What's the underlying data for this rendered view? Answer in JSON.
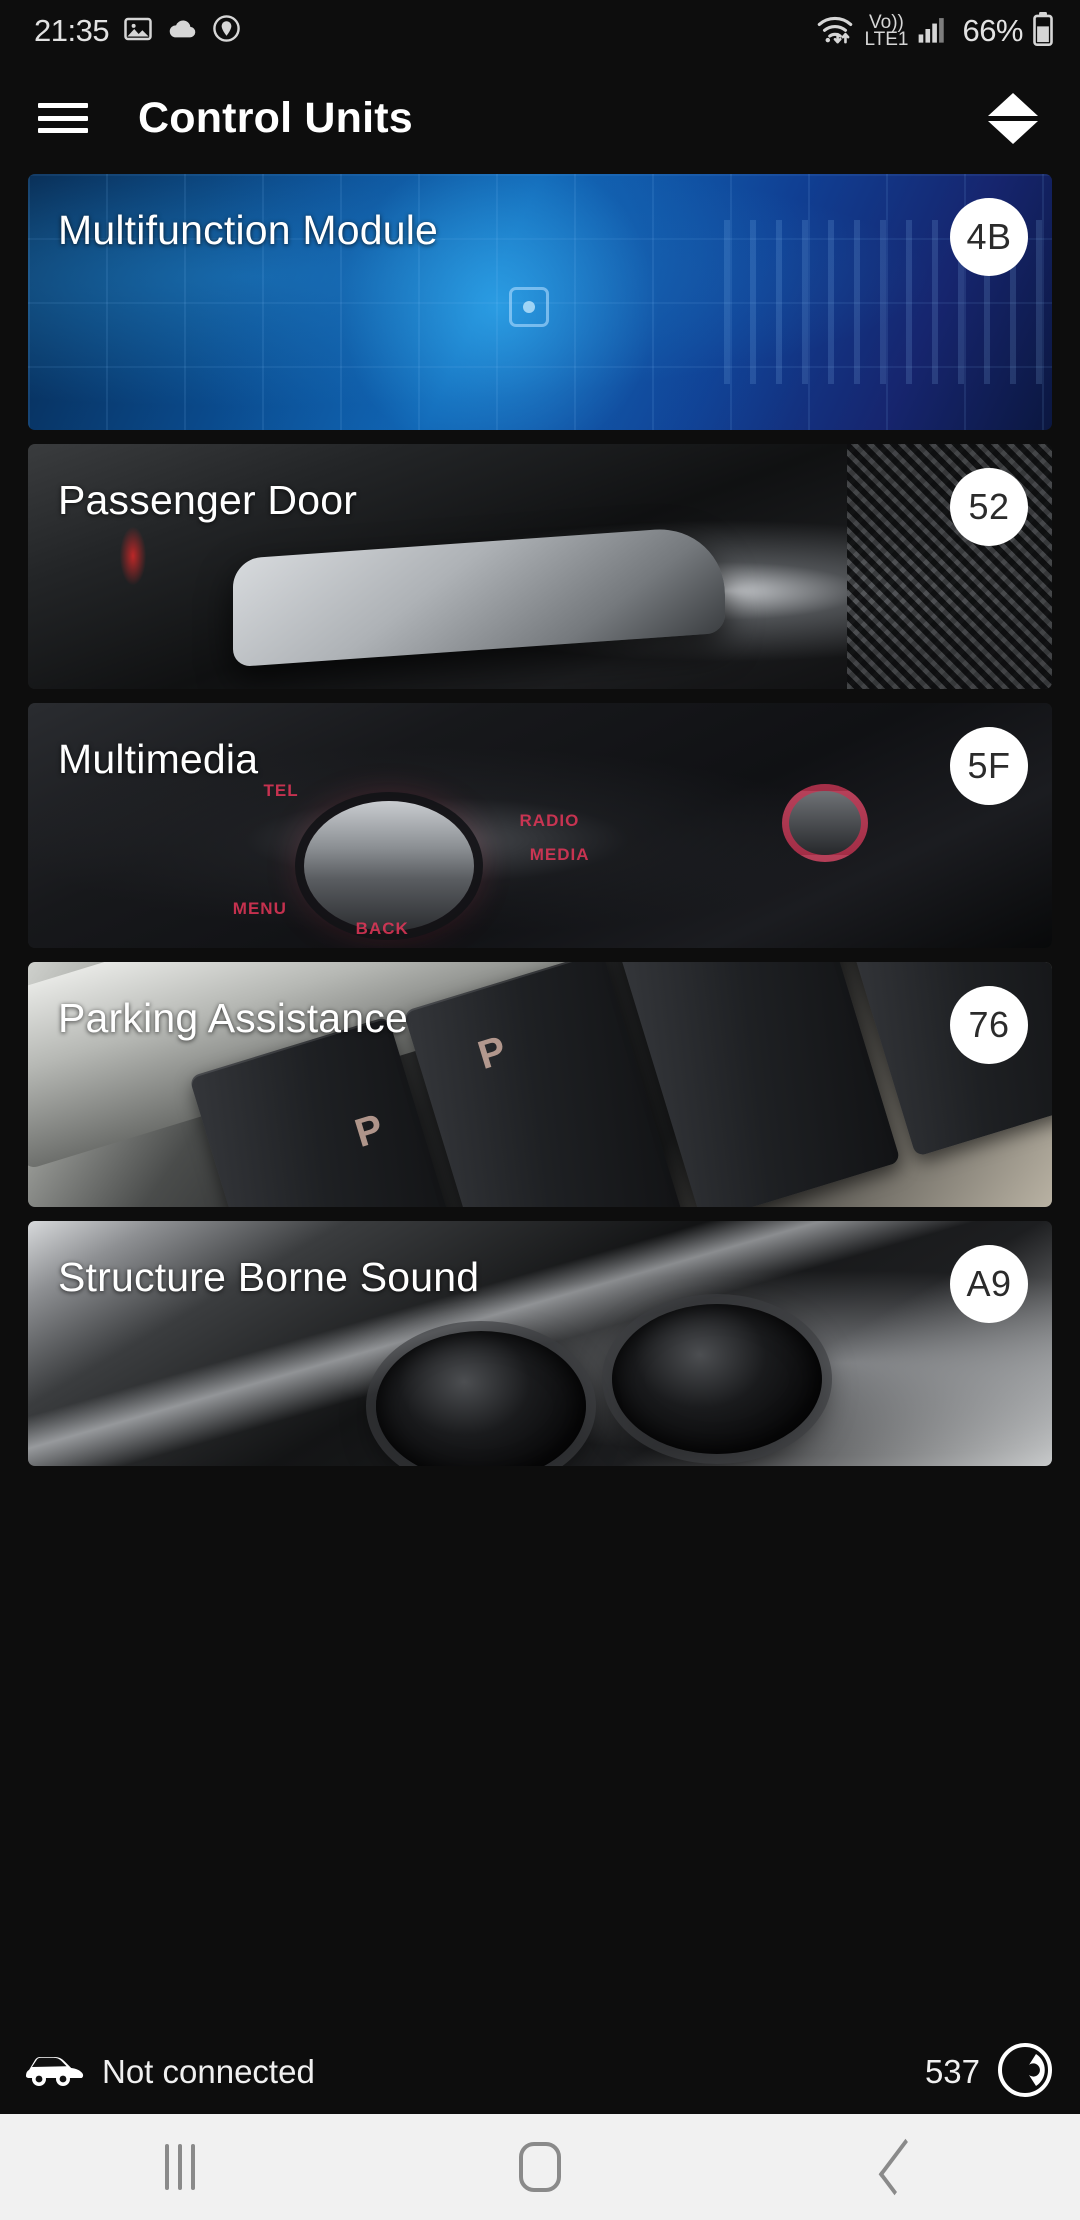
{
  "statusbar": {
    "clock": "21:35",
    "icons_left": [
      "image-icon",
      "cloud-icon",
      "location-pin-icon"
    ],
    "wifi_icon": "wifi-data-transfer-icon",
    "volte_label_top": "Vo))",
    "volte_label_bottom": "LTE1",
    "signal_icon": "cellular-signal-icon",
    "battery_percent": "66%",
    "battery_icon": "battery-icon"
  },
  "appbar": {
    "menu_icon": "hamburger-menu-icon",
    "title": "Control Units",
    "sort_icon": "sort-updown-icon"
  },
  "cards": [
    {
      "title": "Multifunction Module",
      "badge": "4B",
      "art": "art-mfm"
    },
    {
      "title": "Passenger Door",
      "badge": "52",
      "art": "art-door"
    },
    {
      "title": "Multimedia",
      "badge": "5F",
      "art": "art-mmi"
    },
    {
      "title": "Parking Assistance",
      "badge": "76",
      "art": "art-pdc"
    },
    {
      "title": "Structure Borne Sound",
      "badge": "A9",
      "art": "art-sbs"
    }
  ],
  "card_art_labels": {
    "mmi_menu": "MENU",
    "mmi_back": "BACK",
    "mmi_radio": "RADIO",
    "mmi_media": "MEDIA",
    "mmi_tel": "TEL",
    "pdc_sym_left": "P",
    "pdc_sym_right": "P"
  },
  "bottombar": {
    "car_icon": "car-icon",
    "connection_status": "Not connected",
    "count": "537",
    "app_icon": "carly-circle-icon"
  },
  "navbar": {
    "recents_icon": "recents-icon",
    "home_icon": "home-icon",
    "back_icon": "back-icon"
  },
  "colors": {
    "background": "#0d0d0d",
    "badge_bg": "#ffffff",
    "badge_text": "#2b2b2b",
    "navbar_bg": "#f1f1f1"
  }
}
